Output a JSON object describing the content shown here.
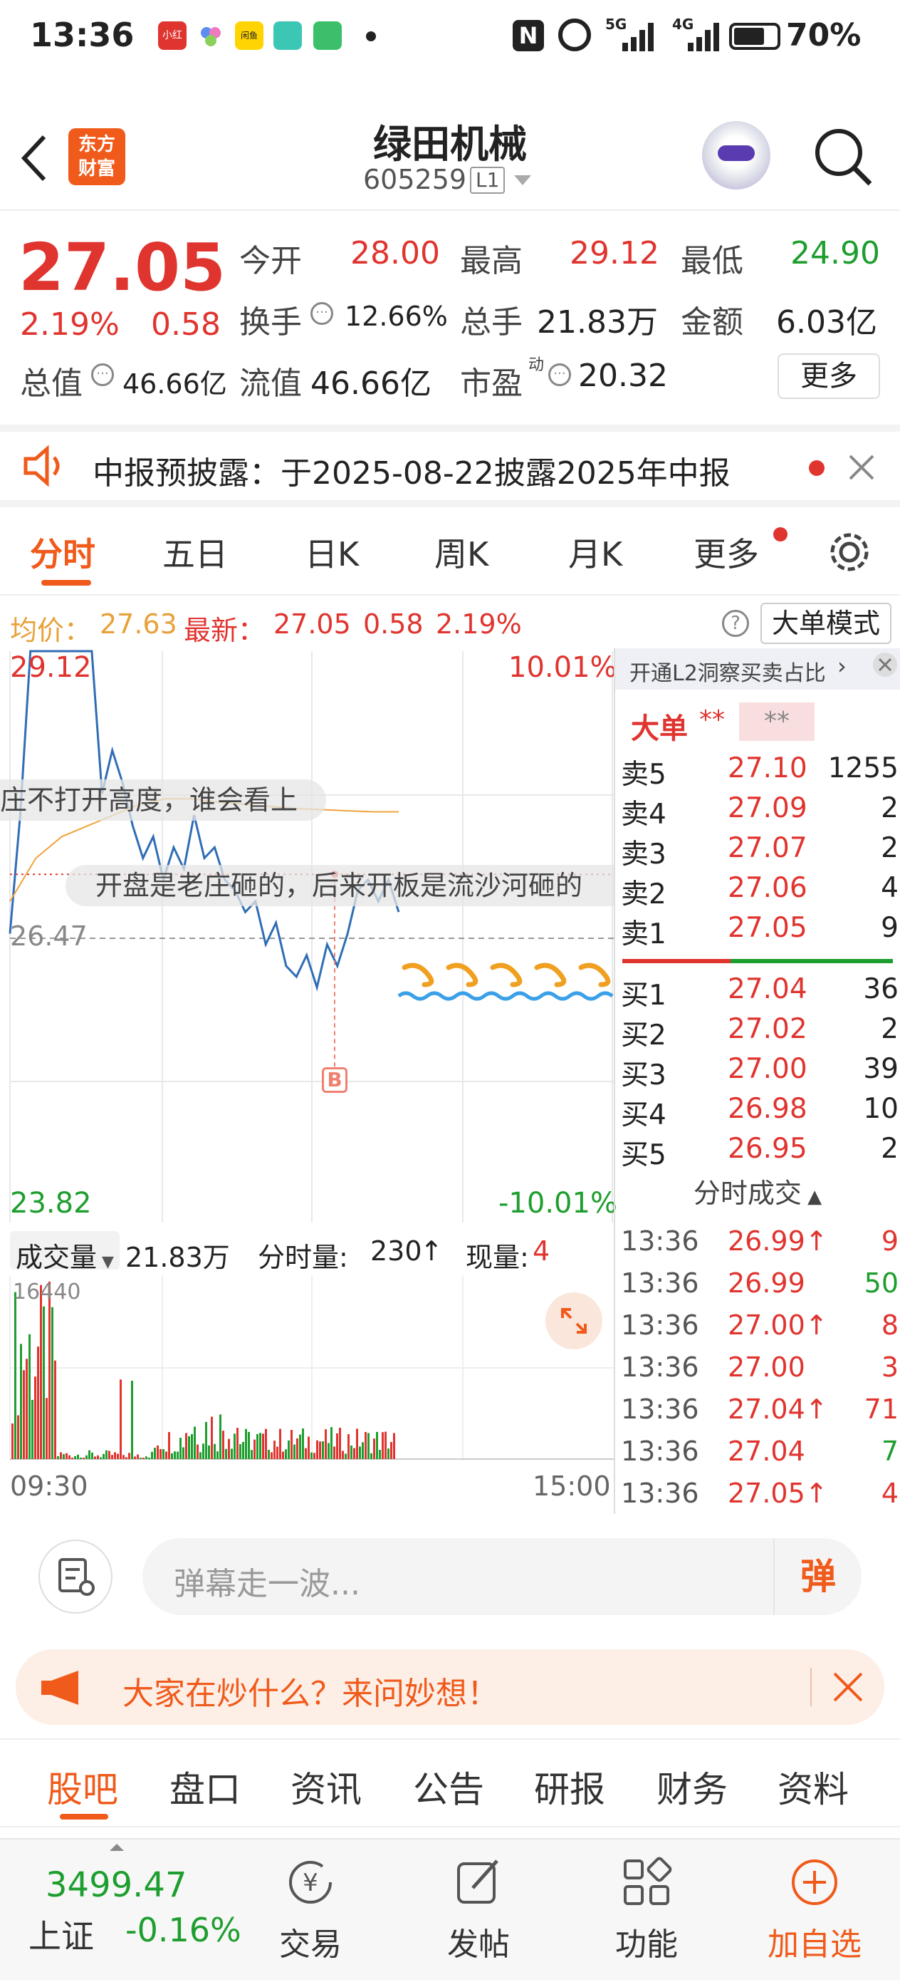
{
  "status_bar": {
    "time": "13:36",
    "app_badges": [
      "小红书",
      "",
      "闲鱼",
      "",
      ""
    ],
    "signal_5g": "5G",
    "signal_4g": "4G",
    "battery": "70%"
  },
  "header": {
    "logo_line1": "东方",
    "logo_line2": "财富",
    "stock_name": "绿田机械",
    "stock_code": "605259",
    "level_badge": "L1"
  },
  "quote": {
    "price": "27.05",
    "change_pct": "2.19%",
    "change_amt": "0.58",
    "open_label": "今开",
    "open": "28.00",
    "high_label": "最高",
    "high": "29.12",
    "low_label": "最低",
    "low": "24.90",
    "turnover_label": "换手",
    "turnover": "12.66%",
    "volume_label": "总手",
    "volume": "21.83万",
    "amount_label": "金额",
    "amount": "6.03亿",
    "mktcap_label": "总值",
    "mktcap": "46.66亿",
    "float_label": "流值",
    "float_cap": "46.66亿",
    "pe_label": "市盈",
    "pe_sup": "动",
    "pe": "20.32",
    "more_button": "更多"
  },
  "notice": {
    "text": "中报预披露：于2025-08-22披露2025年中报"
  },
  "tabs": [
    "分时",
    "五日",
    "日K",
    "周K",
    "月K",
    "更多"
  ],
  "avg_bar": {
    "avg_label": "均价：",
    "avg": "27.63",
    "latest_label": "最新：",
    "latest": "27.05",
    "chg": "0.58",
    "chg_pct": "2.19%",
    "big_order_button": "大单模式"
  },
  "chart": {
    "top_price": "29.12",
    "top_pct": "10.01%",
    "mid_price": "26.47",
    "bottom_price": "23.82",
    "bottom_pct": "-10.01%",
    "danmaku1": "庄不打开高度，谁会看上",
    "danmaku2": "开盘是老庄砸的，后来开板是流沙河砸的",
    "buy_marker": "B",
    "volume_select": "成交量",
    "volume_total": "21.83万",
    "minute_vol_label": "分时量:",
    "minute_vol": "230",
    "current_vol_label": "现量:",
    "current_vol": "4",
    "vol_max": "16440",
    "time_start": "09:30",
    "time_end": "15:00"
  },
  "chart_data": {
    "type": "line",
    "x_range": [
      "09:30",
      "15:00"
    ],
    "ylim": [
      23.82,
      29.12
    ],
    "price_series": [
      26.5,
      27.6,
      29.12,
      29.12,
      29.12,
      29.12,
      29.12,
      29.12,
      29.12,
      27.8,
      28.2,
      27.9,
      27.5,
      27.2,
      27.4,
      27.0,
      27.3,
      27.1,
      27.6,
      27.2,
      27.3,
      27.0,
      26.9,
      26.7,
      26.8,
      26.4,
      26.6,
      26.2,
      26.1,
      26.3,
      26.0,
      26.4,
      26.2,
      26.5,
      26.9,
      27.0,
      26.8,
      27.0,
      26.7
    ],
    "avg_series": [
      26.8,
      27.2,
      27.4,
      27.5,
      27.6,
      27.7,
      27.75,
      27.75,
      27.72,
      27.7,
      27.68,
      27.66,
      27.65,
      27.64,
      27.63,
      27.63
    ],
    "volume_max": 16440
  },
  "order_book": {
    "header_link": "开通L2洞察买卖占比",
    "big_order_label": "大单",
    "masked1": "**",
    "masked2": "**",
    "sells": [
      {
        "label": "卖5",
        "price": "27.10",
        "vol": "1255"
      },
      {
        "label": "卖4",
        "price": "27.09",
        "vol": "2"
      },
      {
        "label": "卖3",
        "price": "27.07",
        "vol": "2"
      },
      {
        "label": "卖2",
        "price": "27.06",
        "vol": "4"
      },
      {
        "label": "卖1",
        "price": "27.05",
        "vol": "9"
      }
    ],
    "buys": [
      {
        "label": "买1",
        "price": "27.04",
        "vol": "36"
      },
      {
        "label": "买2",
        "price": "27.02",
        "vol": "2"
      },
      {
        "label": "买3",
        "price": "27.00",
        "vol": "39"
      },
      {
        "label": "买4",
        "price": "26.98",
        "vol": "10"
      },
      {
        "label": "买5",
        "price": "26.95",
        "vol": "2"
      }
    ],
    "trades_title": "分时成交",
    "trades": [
      {
        "time": "13:36",
        "price": "26.99↑",
        "vol": "9",
        "dir": "red"
      },
      {
        "time": "13:36",
        "price": "26.99",
        "vol": "50",
        "dir": "green"
      },
      {
        "time": "13:36",
        "price": "27.00↑",
        "vol": "8",
        "dir": "red"
      },
      {
        "time": "13:36",
        "price": "27.00",
        "vol": "3",
        "dir": "red"
      },
      {
        "time": "13:36",
        "price": "27.04↑",
        "vol": "71",
        "dir": "red"
      },
      {
        "time": "13:36",
        "price": "27.04",
        "vol": "7",
        "dir": "green"
      },
      {
        "time": "13:36",
        "price": "27.05↑",
        "vol": "4",
        "dir": "red"
      }
    ]
  },
  "comment": {
    "placeholder": "弹幕走一波...",
    "danmaku_button": "弹",
    "promo_text": "大家在炒什么？来问妙想！"
  },
  "bottom_tabs": [
    "股吧",
    "盘口",
    "资讯",
    "公告",
    "研报",
    "财务",
    "资料"
  ],
  "bottom_nav": {
    "index_value": "3499.47",
    "index_name": "上证",
    "index_change": "-0.16%",
    "items": [
      "交易",
      "发帖",
      "功能",
      "加自选"
    ]
  },
  "colors": {
    "up": "#e0342f",
    "down": "#1e9e2e",
    "accent": "#f05a1a",
    "price_line": "#2f6db5",
    "avg_line": "#f0a33b"
  }
}
